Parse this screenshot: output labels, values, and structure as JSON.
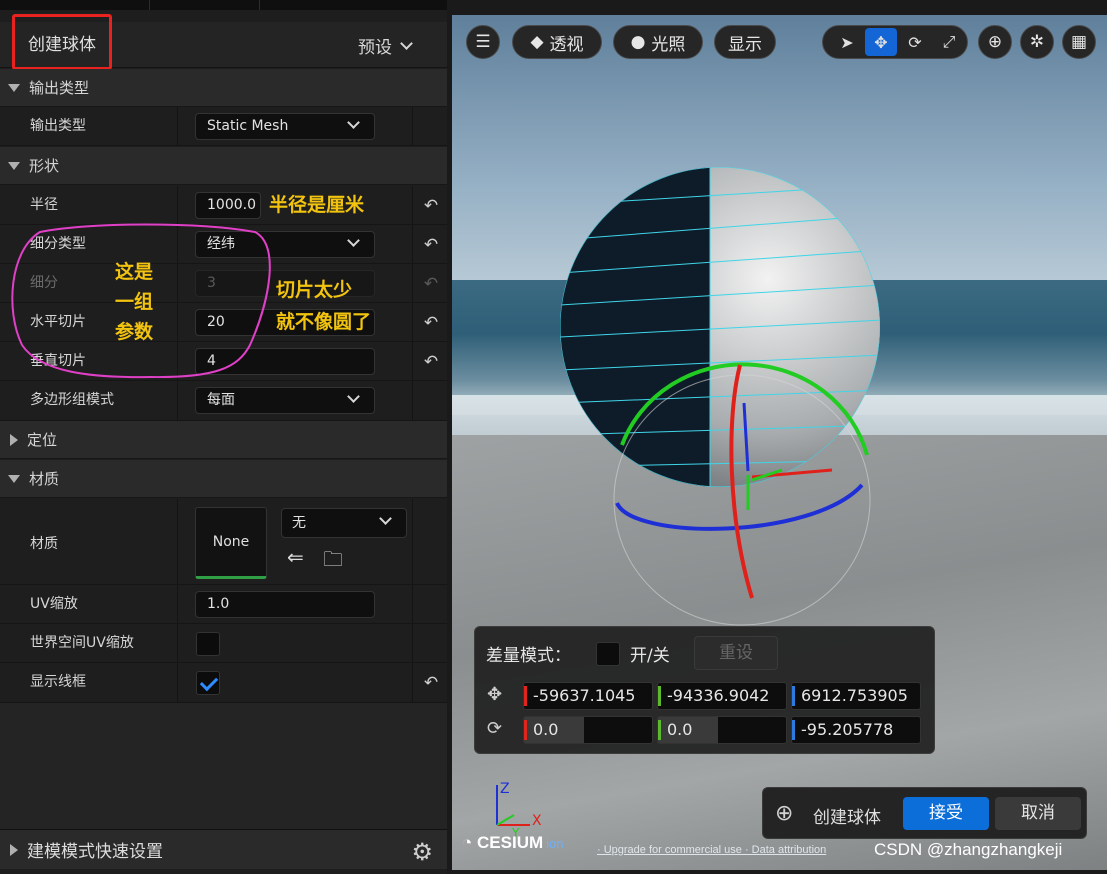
{
  "panel": {
    "title": "创建球体",
    "preset_label": "预设",
    "sections": {
      "output_type": "输出类型",
      "shape": "形状",
      "position": "定位",
      "material": "材质"
    },
    "rows": {
      "output_type": {
        "label": "输出类型",
        "value": "Static Mesh"
      },
      "radius": {
        "label": "半径",
        "value": "1000.0"
      },
      "subdiv_type": {
        "label": "细分类型",
        "value": "经纬"
      },
      "subdiv": {
        "label": "细分",
        "value": "3"
      },
      "h_slices": {
        "label": "水平切片",
        "value": "20"
      },
      "v_slices": {
        "label": "垂直切片",
        "value": "4"
      },
      "polygroup": {
        "label": "多边形组模式",
        "value": "每面"
      },
      "material": {
        "label": "材质",
        "thumb": "None",
        "value": "无"
      },
      "uv_scale": {
        "label": "UV缩放",
        "value": "1.0"
      },
      "world_uv": {
        "label": "世界空间UV缩放",
        "checked": false
      },
      "wireframe": {
        "label": "显示线框",
        "checked": true
      }
    },
    "bottom_label": "建模模式快速设置"
  },
  "annotations": {
    "radius_note": "半径是厘米",
    "group_note_1": "这是",
    "group_note_2": "一组",
    "group_note_3": "参数",
    "slices_note_1": "切片太少",
    "slices_note_2": "就不像圆了"
  },
  "viewport": {
    "perspective": "透视",
    "lighting": "光照",
    "show": "显示",
    "delta": {
      "title": "差量模式：",
      "on_off": "开/关",
      "reset": "重设",
      "loc_x": "-59637.1045",
      "loc_y": "-94336.9042",
      "loc_z": "6912.753905",
      "rot_x": "0.0",
      "rot_y": "0.0",
      "rot_z": "-95.205778"
    },
    "accept_bar": {
      "label": "创建球体",
      "accept": "接受",
      "cancel": "取消"
    },
    "axis_z": "Z",
    "axis_x": "X",
    "axis_y": "Y",
    "cesium": "CESIUM",
    "cesium_ion": "ion",
    "cesium_links": "· Upgrade for commercial use · Data attribution",
    "watermark": "CSDN @zhangzhangkeji"
  },
  "colors": {
    "highlight_box": "#e8231f",
    "annotation": "#f2c40f",
    "lasso": "#e040c8",
    "accent": "#0c6ed9"
  }
}
